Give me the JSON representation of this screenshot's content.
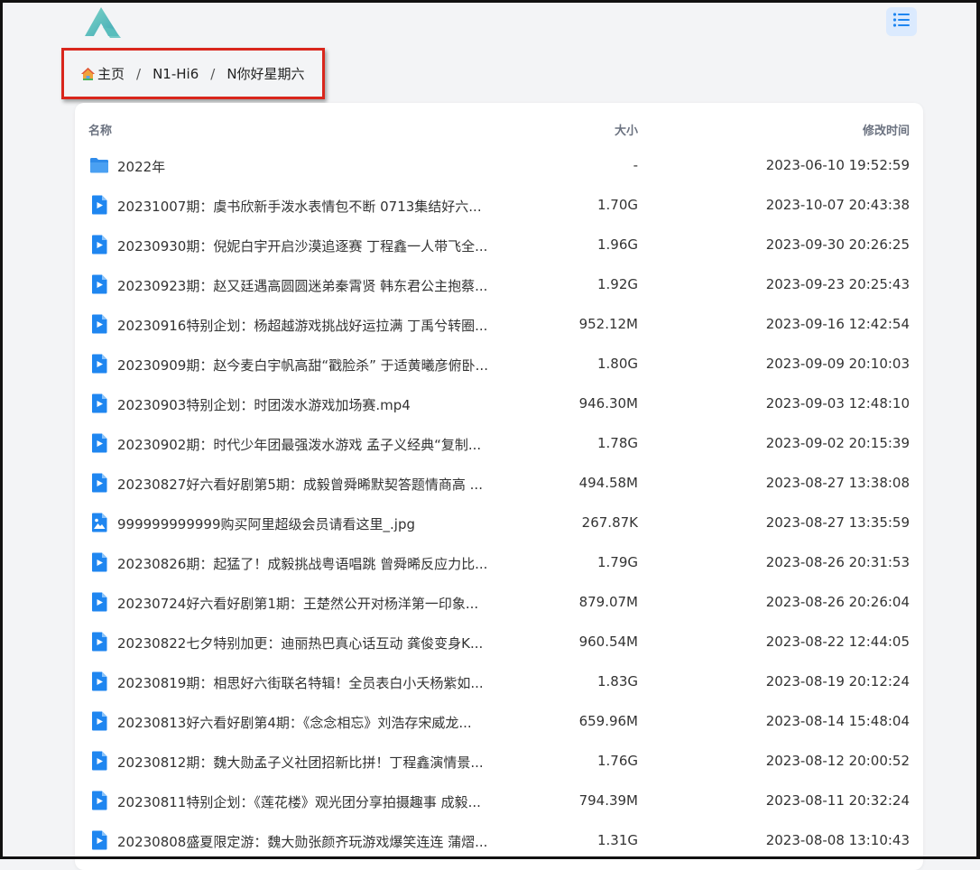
{
  "header": {
    "logo_icon": "alist-logo-icon",
    "menu_icon": "list-menu-icon",
    "accent_color": "#1f86f0"
  },
  "breadcrumb": {
    "home_icon": "house-icon",
    "items": [
      "主页",
      "N1-Hi6",
      "N你好星期六"
    ],
    "separator": "/"
  },
  "table": {
    "headers": {
      "name": "名称",
      "size": "大小",
      "modified": "修改时间"
    },
    "rows": [
      {
        "type": "folder",
        "name": "2022年",
        "size": "-",
        "modified": "2023-06-10 19:52:59"
      },
      {
        "type": "video",
        "name": "20231007期：虞书欣新手泼水表情包不断 0713集结好六...",
        "size": "1.70G",
        "modified": "2023-10-07 20:43:38"
      },
      {
        "type": "video",
        "name": "20230930期：倪妮白宇开启沙漠追逐赛 丁程鑫一人带飞全...",
        "size": "1.96G",
        "modified": "2023-09-30 20:26:25"
      },
      {
        "type": "video",
        "name": "20230923期：赵又廷遇高圆圆迷弟秦霄贤 韩东君公主抱蔡...",
        "size": "1.92G",
        "modified": "2023-09-23 20:25:43"
      },
      {
        "type": "video",
        "name": "20230916特别企划：杨超越游戏挑战好运拉满 丁禹兮转圈...",
        "size": "952.12M",
        "modified": "2023-09-16 12:42:54"
      },
      {
        "type": "video",
        "name": "20230909期：赵今麦白宇帆高甜“戳脸杀” 于适黄曦彦俯卧...",
        "size": "1.80G",
        "modified": "2023-09-09 20:10:03"
      },
      {
        "type": "video",
        "name": "20230903特别企划：时团泼水游戏加场赛.mp4",
        "size": "946.30M",
        "modified": "2023-09-03 12:48:10"
      },
      {
        "type": "video",
        "name": "20230902期：时代少年团最强泼水游戏 孟子义经典“复制...",
        "size": "1.78G",
        "modified": "2023-09-02 20:15:39"
      },
      {
        "type": "video",
        "name": "20230827好六看好剧第5期：成毅曾舜晞默契答题情商高 ...",
        "size": "494.58M",
        "modified": "2023-08-27 13:38:08"
      },
      {
        "type": "image",
        "name": "999999999999购买阿里超级会员请看这里_.jpg",
        "size": "267.87K",
        "modified": "2023-08-27 13:35:59"
      },
      {
        "type": "video",
        "name": "20230826期：起猛了！成毅挑战粤语唱跳 曾舜晞反应力比...",
        "size": "1.79G",
        "modified": "2023-08-26 20:31:53"
      },
      {
        "type": "video",
        "name": "20230724好六看好剧第1期：王楚然公开对杨洋第一印象...",
        "size": "879.07M",
        "modified": "2023-08-26 20:26:04"
      },
      {
        "type": "video",
        "name": "20230822七夕特别加更：迪丽热巴真心话互动 龚俊变身K...",
        "size": "960.54M",
        "modified": "2023-08-22 12:44:05"
      },
      {
        "type": "video",
        "name": "20230819期：相思好六街联名特辑！全员表白小夭杨紫如...",
        "size": "1.83G",
        "modified": "2023-08-19 20:12:24"
      },
      {
        "type": "video",
        "name": "20230813好六看好剧第4期：《念念相忘》刘浩存宋威龙...",
        "size": "659.96M",
        "modified": "2023-08-14 15:48:04"
      },
      {
        "type": "video",
        "name": "20230812期：魏大勋孟子义社团招新比拼！丁程鑫演情景...",
        "size": "1.76G",
        "modified": "2023-08-12 20:00:52"
      },
      {
        "type": "video",
        "name": "20230811特别企划：《莲花楼》观光团分享拍摄趣事 成毅...",
        "size": "794.39M",
        "modified": "2023-08-11 20:32:24"
      },
      {
        "type": "video",
        "name": "20230808盛夏限定游：魏大勋张颜齐玩游戏爆笑连连 蒲熠...",
        "size": "1.31G",
        "modified": "2023-08-08 13:10:43"
      }
    ]
  }
}
